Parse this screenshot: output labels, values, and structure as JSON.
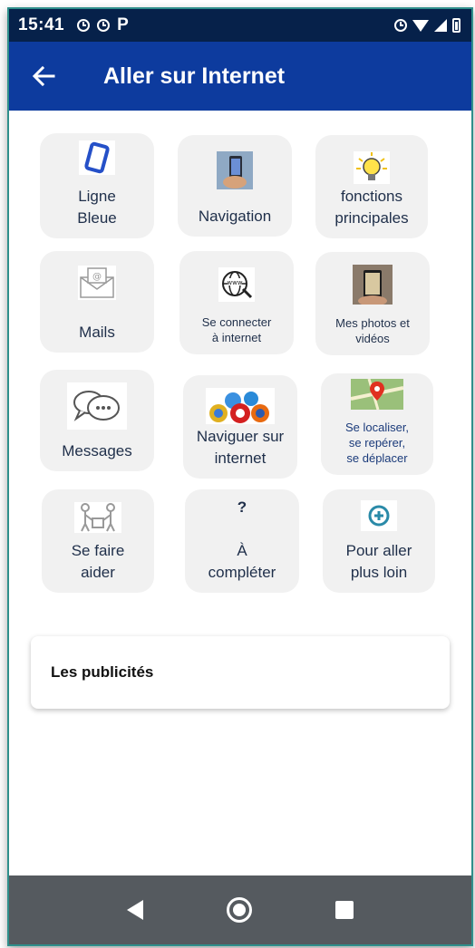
{
  "status_bar": {
    "time": "15:41",
    "p_icon": "P",
    "icons": [
      "alarm-icon",
      "alarm-icon",
      "parking-icon",
      "alarm-icon",
      "wifi-icon",
      "signal-icon",
      "battery-icon"
    ]
  },
  "app_bar": {
    "title": "Aller sur Internet",
    "back_icon": "arrow-left-icon"
  },
  "tiles": [
    {
      "label1": "Ligne",
      "label2": "Bleue",
      "icon": "phone-outline-icon"
    },
    {
      "label1": "Navigation",
      "label2": "",
      "icon": "hand-smartphone-icon"
    },
    {
      "label1": "fonctions",
      "label2": "principales",
      "icon": "lightbulb-icon"
    },
    {
      "label1": "Mails",
      "label2": "",
      "icon": "envelope-icon"
    },
    {
      "label1": "Se connecter",
      "label2": "à internet",
      "icon": "globe-www-icon"
    },
    {
      "label1": "Mes photos et",
      "label2": "vidéos",
      "icon": "photo-phone-icon"
    },
    {
      "label1": "Messages",
      "label2": "",
      "icon": "chat-bubbles-icon"
    },
    {
      "label1": "Naviguer sur",
      "label2": "internet",
      "icon": "browsers-icon"
    },
    {
      "label1": "Se localiser,",
      "label2": "se repérer,",
      "label3": "se déplacer",
      "icon": "map-pin-icon"
    },
    {
      "label1": "Se faire",
      "label2": "aider",
      "icon": "helping-people-icon"
    },
    {
      "glyph": "?",
      "label1": "À",
      "label2": "compléter",
      "icon": "question-icon"
    },
    {
      "label1": "Pour aller",
      "label2": "plus loin",
      "icon": "plus-circle-icon"
    }
  ],
  "ads_card": {
    "title": "Les publicités"
  },
  "colors": {
    "status_bar": "#06214a",
    "app_bar": "#0d3b9e",
    "tile_bg": "#f1f1f1",
    "nav_bar": "#555a5f"
  }
}
